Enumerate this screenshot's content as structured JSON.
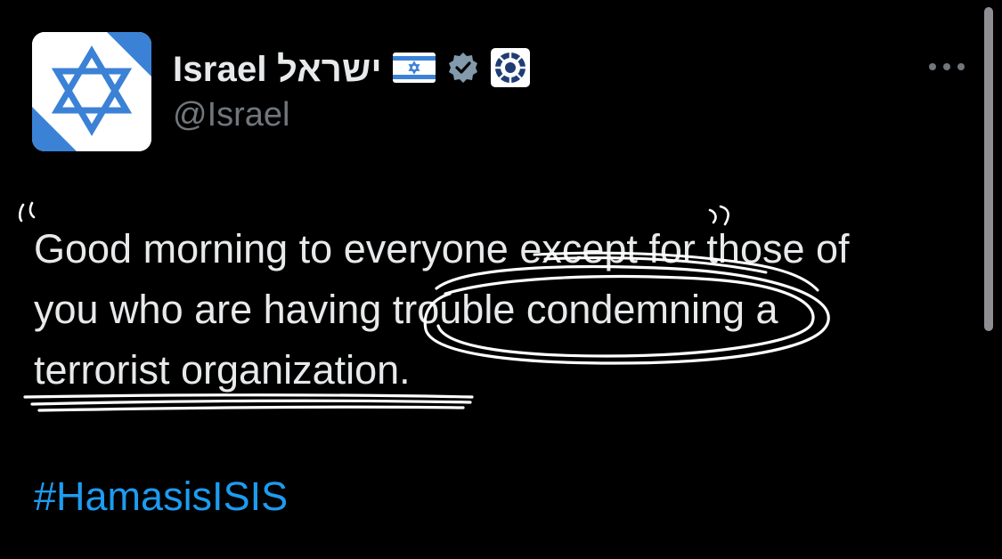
{
  "post": {
    "author": {
      "display_name": "Israel ישראל",
      "handle": "@Israel",
      "verified_badge_icon": "verified-badge-icon",
      "flag_icon": "israel-flag-icon",
      "affiliation_icon": "government-seal-icon"
    },
    "menu_icon": "more-options-icon",
    "text_lines": [
      "Good morning to everyone except for those of",
      "you who are having trouble condemning a",
      "terrorist organization."
    ],
    "hashtag": "#HamasisISIS"
  },
  "annotations": {
    "open_quote": "“",
    "close_quote": "”",
    "circled_phrase_icon": "hand-drawn-ellipse",
    "underline_icon": "hand-drawn-underline",
    "strike_icon": "hand-drawn-strikethrough"
  },
  "colors": {
    "background": "#000000",
    "text": "#e7e9ea",
    "secondary_text": "#71767b",
    "hashtag": "#1d9bf0",
    "flag_blue": "#3b82d6",
    "verified_badge": "#829aab",
    "ink": "#ffffff"
  }
}
